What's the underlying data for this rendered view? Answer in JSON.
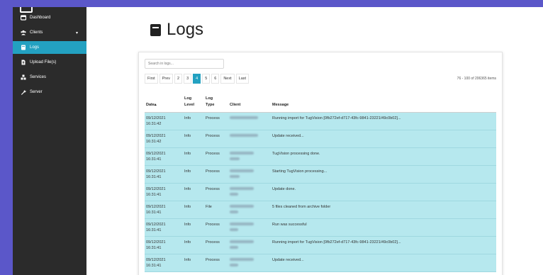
{
  "sidebar": {
    "items": [
      {
        "label": "Dashboard",
        "icon": "dashboard-icon"
      },
      {
        "label": "Clients",
        "icon": "users-icon",
        "chevron": "▾"
      },
      {
        "label": "Logs",
        "icon": "logs-icon",
        "active": true
      },
      {
        "label": "Upload File(s)",
        "icon": "upload-file-icon"
      },
      {
        "label": "Services",
        "icon": "services-icon"
      },
      {
        "label": "Server",
        "icon": "wrench-icon"
      }
    ]
  },
  "page": {
    "title": "Logs"
  },
  "search": {
    "placeholder": "Search in logs..."
  },
  "pagination": {
    "first": "First",
    "prev": "Prev",
    "pages": [
      "2",
      "3",
      "4",
      "5",
      "6"
    ],
    "active_page": "4",
    "next": "Next",
    "last": "Last"
  },
  "count_text": "76 - 100 of 206365 items",
  "table": {
    "headers": {
      "date": "Date▴",
      "level": "Log Level",
      "type": "Log Type",
      "client": "Client",
      "message": "Message"
    },
    "rows": [
      {
        "date": "09/12/2021 16:31:42",
        "level": "Info",
        "type": "Process",
        "message": "Running import for TugVision [0fb272ef-d717-43fc-9841-23221/49c0b02]..."
      },
      {
        "date": "09/12/2021 16:31:42",
        "level": "Info",
        "type": "Process",
        "message": "Update received..."
      },
      {
        "date": "09/12/2021 16:31:41",
        "level": "Info",
        "type": "Process",
        "message": "TugVision processing done."
      },
      {
        "date": "09/12/2021 16:31:41",
        "level": "Info",
        "type": "Process",
        "message": "Starting TugVision processing..."
      },
      {
        "date": "09/12/2021 16:31:41",
        "level": "Info",
        "type": "Process",
        "message": "Update done."
      },
      {
        "date": "09/12/2021 16:31:41",
        "level": "Info",
        "type": "File",
        "message": "5 files cleaned from archive folder"
      },
      {
        "date": "09/12/2021 16:31:41",
        "level": "Info",
        "type": "Process",
        "message": "Run was successful"
      },
      {
        "date": "09/12/2021 16:31:41",
        "level": "Info",
        "type": "Process",
        "message": "Running import for TugVision [0fb272ef-d717-43fc-9841-23221/49c0b02]..."
      },
      {
        "date": "09/12/2021 16:31:41",
        "level": "Info",
        "type": "Process",
        "message": "Update received..."
      }
    ]
  },
  "colors": {
    "background": "#5b57c9",
    "sidebar": "#2b2b2b",
    "accent": "#23a1c1",
    "row_highlight": "#b6e8ee"
  }
}
